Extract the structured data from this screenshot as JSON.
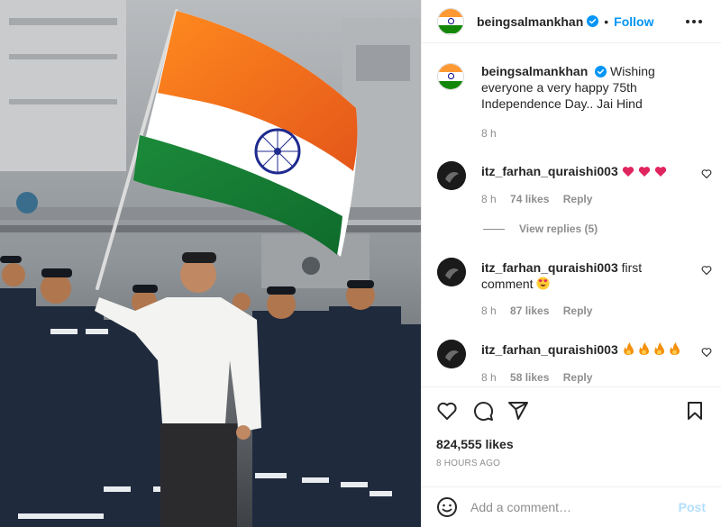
{
  "post": {
    "username": "beingsalmankhan",
    "follow_label": "Follow",
    "separator": "•",
    "caption": "Wishing everyone a very happy 75th Independence Day.. Jai Hind",
    "caption_time": "8 h",
    "likes": "824,555 likes",
    "posted_ago": "8 HOURS AGO"
  },
  "comments": [
    {
      "username": "itz_farhan_quraishi003",
      "text": "",
      "emoji": "heart-emoji x3",
      "time": "8 h",
      "likes": "74 likes",
      "reply_label": "Reply"
    },
    {
      "username": "itz_farhan_quraishi003",
      "text": "first comment",
      "emoji": "heart-eyes-emoji",
      "time": "8 h",
      "likes": "87 likes",
      "reply_label": "Reply"
    },
    {
      "username": "itz_farhan_quraishi003",
      "text": "",
      "emoji": "fire-emoji x4",
      "time": "8 h",
      "likes": "58 likes",
      "reply_label": "Reply"
    }
  ],
  "view_replies": "View replies (5)",
  "add_comment": {
    "placeholder": "Add a comment…",
    "post_label": "Post"
  },
  "icons": [
    "verified-badge-icon",
    "more-options-icon",
    "like-icon",
    "comment-icon",
    "share-icon",
    "save-icon",
    "emoji-icon"
  ],
  "colors": {
    "accent": "#0095f6",
    "post_disabled": "#b2dffc",
    "muted": "#8e8e8e",
    "heart": "#ed4956",
    "flag_saffron": "#ff9933",
    "flag_green": "#138808",
    "chakra": "#000080"
  }
}
